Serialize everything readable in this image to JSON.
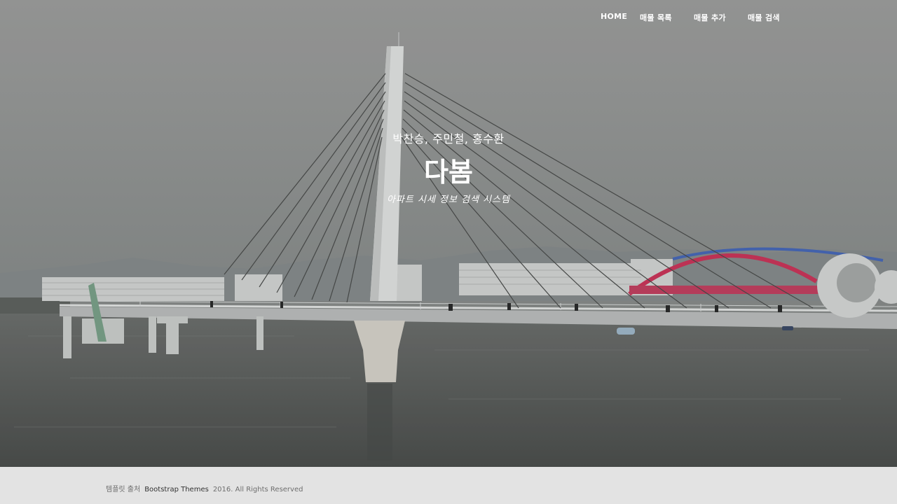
{
  "nav": {
    "items": [
      {
        "label": "HOME"
      },
      {
        "label": "매물 목록"
      },
      {
        "label": "매물 추가"
      },
      {
        "label": "매물 검색"
      }
    ]
  },
  "hero": {
    "subtitle": "박찬승, 주민철, 홍수환",
    "title": "다봄",
    "tagline": "아파트 시세 정보 검색 시스템"
  },
  "footer": {
    "label": "템플릿 출처",
    "link": "Bootstrap Themes",
    "copyright": "2016. All Rights Reserved"
  },
  "colors": {
    "sky": "#9a9b9a",
    "water": "#5a5d5b",
    "footer_bg": "#e3e3e3",
    "arch_accent": "#c8365a"
  }
}
